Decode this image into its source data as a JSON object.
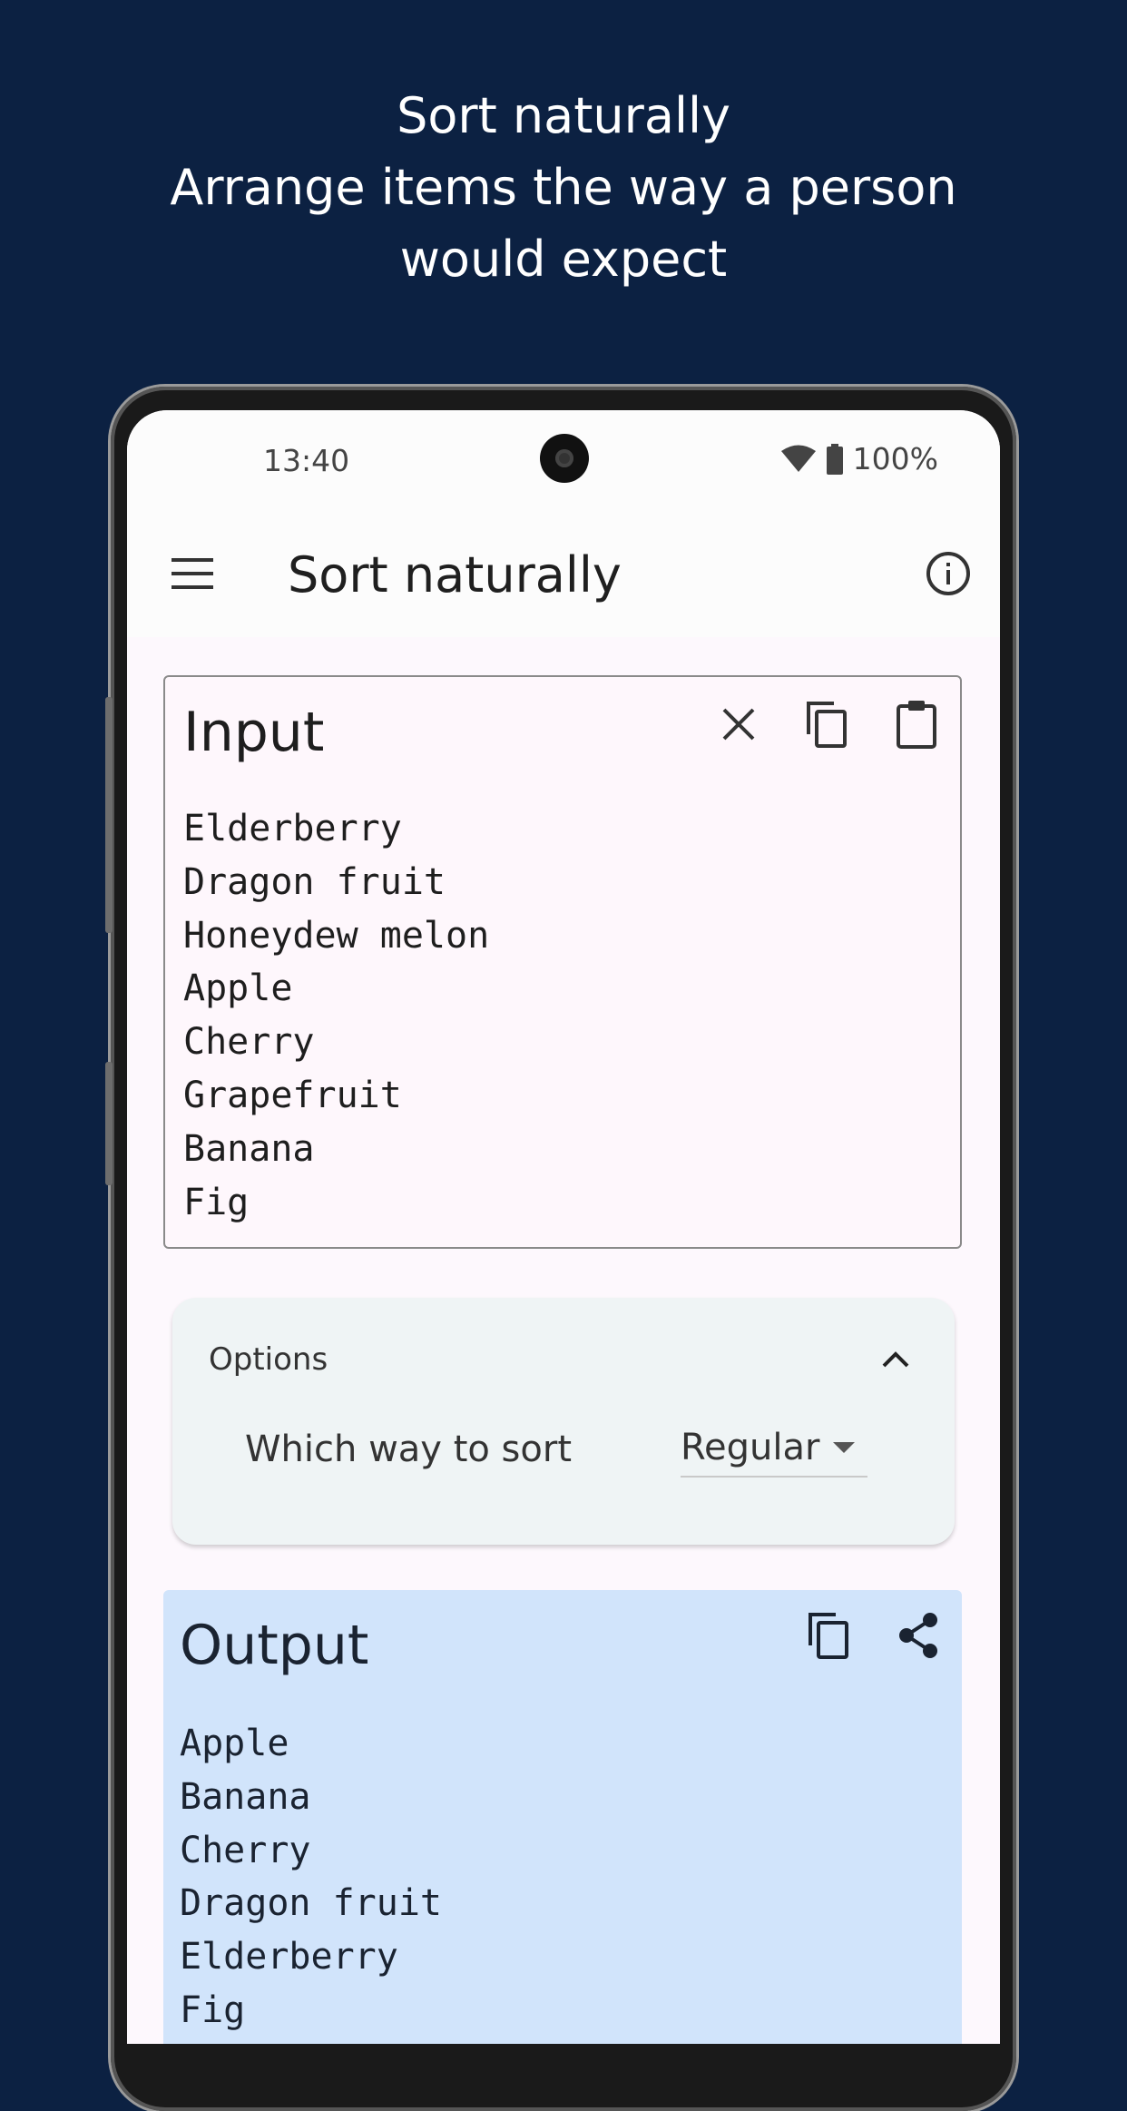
{
  "promo": {
    "line1": "Sort naturally",
    "line2": "Arrange items the way a person",
    "line3": "would expect"
  },
  "status_bar": {
    "time": "13:40",
    "battery": "100%"
  },
  "app_bar": {
    "title": "Sort naturally",
    "menu_icon": "menu-icon",
    "info_icon": "info-icon"
  },
  "input": {
    "title": "Input",
    "actions": [
      "clear-icon",
      "copy-icon",
      "paste-icon"
    ],
    "items": [
      "Elderberry",
      "Dragon fruit",
      "Honeydew melon",
      "Apple",
      "Cherry",
      "Grapefruit",
      "Banana",
      "Fig"
    ]
  },
  "options": {
    "label": "Options",
    "sort_label": "Which way to sort",
    "sort_value": "Regular"
  },
  "output": {
    "title": "Output",
    "actions": [
      "copy-icon",
      "share-icon"
    ],
    "items": [
      "Apple",
      "Banana",
      "Cherry",
      "Dragon fruit",
      "Elderberry",
      "Fig"
    ]
  },
  "colors": {
    "background": "#0c2142",
    "output_card": "#d1e4fb",
    "options_card": "#eff4f5",
    "input_card": "#fef7fc"
  }
}
